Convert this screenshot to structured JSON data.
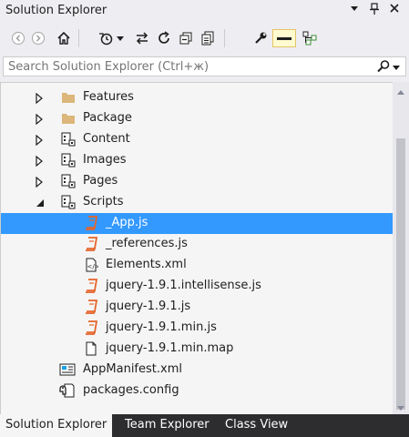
{
  "window": {
    "title": "Solution Explorer"
  },
  "search": {
    "placeholder": "Search Solution Explorer (Ctrl+ж)"
  },
  "toolbar": {
    "buttons": [
      "back-icon",
      "forward-icon",
      "home-icon",
      "history-icon",
      "dropdown-icon",
      "sync-icon",
      "refresh-icon",
      "collapse-all-icon",
      "show-all-files-icon",
      "properties-icon",
      "preview-icon",
      "class-diagram-icon"
    ]
  },
  "tree": {
    "items": [
      {
        "label": "Features",
        "icon": "folder-icon",
        "expander": "collapsed"
      },
      {
        "label": "Package",
        "icon": "folder-icon",
        "expander": "collapsed"
      },
      {
        "label": "Content",
        "icon": "module-icon",
        "expander": "collapsed"
      },
      {
        "label": "Images",
        "icon": "module-icon",
        "expander": "collapsed"
      },
      {
        "label": "Pages",
        "icon": "module-icon",
        "expander": "collapsed"
      },
      {
        "label": "Scripts",
        "icon": "module-icon",
        "expander": "expanded"
      },
      {
        "label": "_App.js",
        "icon": "js-file-icon",
        "selected": true
      },
      {
        "label": "_references.js",
        "icon": "js-file-icon"
      },
      {
        "label": "Elements.xml",
        "icon": "xml-file-icon"
      },
      {
        "label": "jquery-1.9.1.intellisense.js",
        "icon": "js-file-icon"
      },
      {
        "label": "jquery-1.9.1.js",
        "icon": "js-file-icon"
      },
      {
        "label": "jquery-1.9.1.min.js",
        "icon": "js-file-icon"
      },
      {
        "label": "jquery-1.9.1.min.map",
        "icon": "file-icon"
      },
      {
        "label": "AppManifest.xml",
        "icon": "manifest-icon"
      },
      {
        "label": "packages.config",
        "icon": "config-icon"
      }
    ]
  },
  "tabs": [
    {
      "label": "Solution Explorer",
      "active": true
    },
    {
      "label": "Team Explorer"
    },
    {
      "label": "Class View"
    }
  ],
  "colors": {
    "selection": "#3399ff",
    "tab_strip": "#2d2d30",
    "js_icon": "#e5642a",
    "folder": "#dcb67a"
  }
}
